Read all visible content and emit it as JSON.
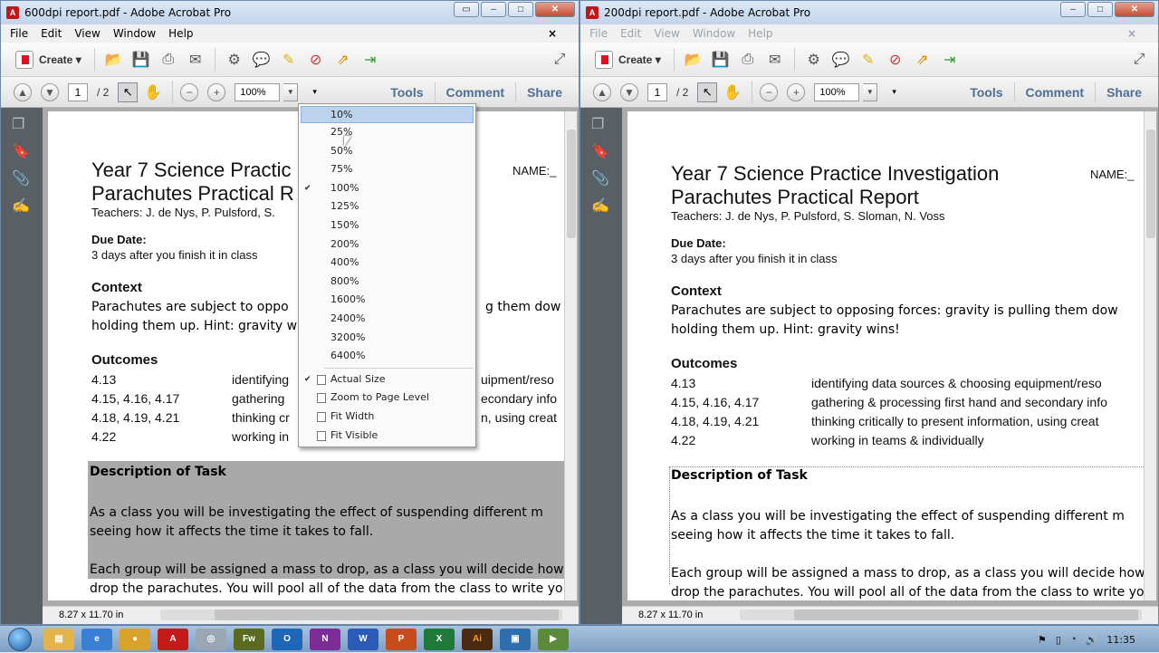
{
  "left": {
    "title": "600dpi report.pdf - Adobe Acrobat Pro",
    "menu": [
      "File",
      "Edit",
      "View",
      "Window",
      "Help"
    ],
    "create": "Create",
    "page_num": "1",
    "page_total": "/ 2",
    "zoom": "100%",
    "tabs": [
      "Tools",
      "Comment",
      "Share"
    ],
    "status": "8.27 x 11.70 in"
  },
  "right": {
    "title": "200dpi report.pdf - Adobe Acrobat Pro",
    "menu": [
      "File",
      "Edit",
      "View",
      "Window",
      "Help"
    ],
    "create": "Create",
    "page_num": "1",
    "page_total": "/ 2",
    "zoom": "100%",
    "tabs": [
      "Tools",
      "Comment",
      "Share"
    ],
    "status": "8.27 x 11.70 in"
  },
  "doc_left": {
    "title1": "Year 7 Science Practic",
    "title2": "Parachutes Practical R",
    "teachers": "Teachers: J. de Nys, P. Pulsford, S.",
    "name": "NAME:_",
    "due_label": "Due Date:",
    "due_text": "3 days after you finish it in class",
    "context_label": "Context",
    "context_line1": "Parachutes are subject to oppo",
    "context_line1b": "g them dow",
    "context_line2": "holding them up. Hint: gravity wi",
    "outcomes_label": "Outcomes",
    "outcomes": [
      {
        "code": "4.13",
        "text": "identifying",
        "tail": "uipment/reso"
      },
      {
        "code": "4.15, 4.16, 4.17",
        "text": "gathering",
        "tail": "econdary info"
      },
      {
        "code": "4.18, 4.19, 4.21",
        "text": "thinking cr",
        "tail": "n, using creat"
      },
      {
        "code": "4.22",
        "text": "working in",
        "tail": ""
      }
    ],
    "task_label": "Description of Task",
    "task1": "As a class you will be investigating the effect of suspending different m",
    "task2": "seeing how it affects the time it takes to fall.",
    "task3": "Each group will be assigned a mass to drop, as a class you will decide how",
    "task4": "drop the parachutes. You will pool all of the data from the class to write yo"
  },
  "doc_right": {
    "title1": "Year 7 Science Practice Investigation",
    "title2": "Parachutes Practical Report",
    "teachers": "Teachers: J. de Nys, P. Pulsford, S. Sloman, N. Voss",
    "name": "NAME:_",
    "due_label": "Due Date:",
    "due_text": "3 days after you finish it in class",
    "context_label": "Context",
    "context_line1": "Parachutes are subject to opposing forces: gravity is pulling them dow",
    "context_line2": "holding them up. Hint: gravity wins!",
    "outcomes_label": "Outcomes",
    "outcomes": [
      {
        "code": "4.13",
        "text": "identifying data sources & choosing equipment/reso"
      },
      {
        "code": "4.15, 4.16, 4.17",
        "text": "gathering & processing first hand and secondary info"
      },
      {
        "code": "4.18, 4.19, 4.21",
        "text": "thinking critically to present information, using creat"
      },
      {
        "code": "4.22",
        "text": "working in teams & individually"
      }
    ],
    "task_label": "Description of Task",
    "task1": "As a class you will be investigating the effect of suspending different m",
    "task2": "seeing how it affects the time it takes to fall.",
    "task3": "Each group will be assigned a mass to drop, as a class you will decide how",
    "task4": "drop the parachutes. You will pool all of the data from the class to write yo"
  },
  "zoom_menu": {
    "levels": [
      "10%",
      "25%",
      "50%",
      "75%",
      "100%",
      "125%",
      "150%",
      "200%",
      "400%",
      "800%",
      "1600%",
      "2400%",
      "3200%",
      "6400%"
    ],
    "checked": "100%",
    "highlighted": "10%",
    "fit_options": [
      "Actual Size",
      "Zoom to Page Level",
      "Fit Width",
      "Fit Visible"
    ],
    "fit_checked": "Actual Size"
  },
  "taskbar": {
    "clock": "11:35"
  }
}
